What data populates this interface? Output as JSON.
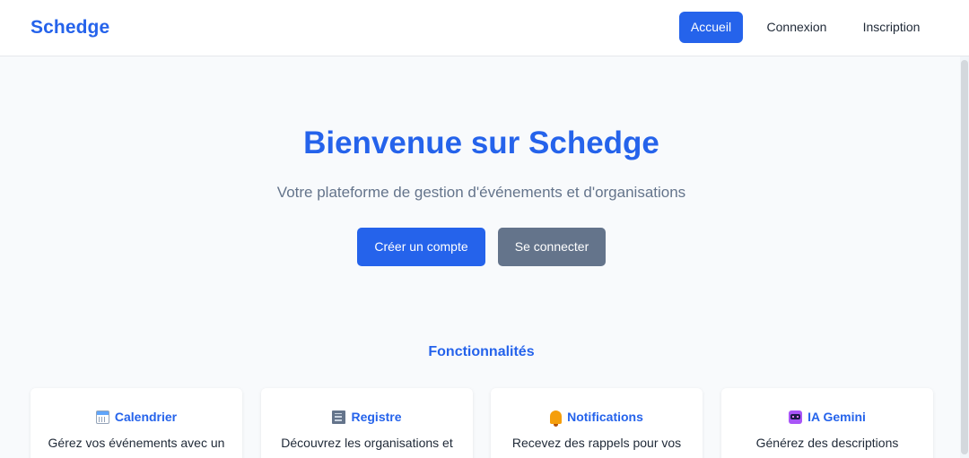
{
  "navbar": {
    "brand": "Schedge",
    "links": [
      {
        "label": "Accueil",
        "active": true
      },
      {
        "label": "Connexion",
        "active": false
      },
      {
        "label": "Inscription",
        "active": false
      }
    ]
  },
  "hero": {
    "title": "Bienvenue sur Schedge",
    "subtitle": "Votre plateforme de gestion d'événements et d'organisations",
    "primary_button": "Créer un compte",
    "secondary_button": "Se connecter"
  },
  "features": {
    "title": "Fonctionnalités",
    "cards": [
      {
        "icon": "calendar-icon",
        "title": "Calendrier",
        "desc": "Gérez vos événements avec un"
      },
      {
        "icon": "building-icon",
        "title": "Registre",
        "desc": "Découvrez les organisations et"
      },
      {
        "icon": "bell-icon",
        "title": "Notifications",
        "desc": "Recevez des rappels pour vos"
      },
      {
        "icon": "robot-icon",
        "title": "IA Gemini",
        "desc": "Générez des descriptions"
      }
    ]
  },
  "colors": {
    "accent": "#2563eb",
    "secondary_button": "#64748b",
    "background": "#f8fafc"
  }
}
